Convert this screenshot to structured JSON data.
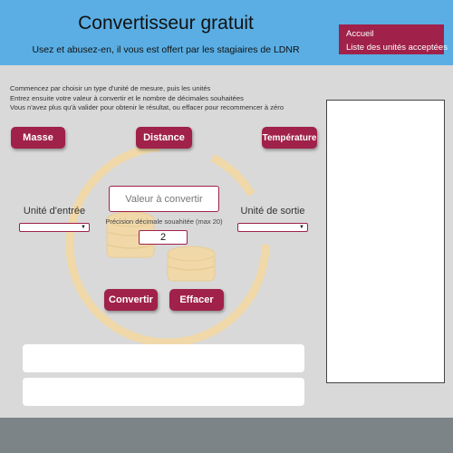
{
  "header": {
    "title": "Convertisseur gratuit",
    "subtitle": "Usez et abusez-en, il vous est offert par les stagiaires de LDNR",
    "nav": [
      "Accueil",
      "Liste des unités acceptées"
    ]
  },
  "instructions": [
    "Commencez par choisir un type d'unité de mesure, puis les unités",
    "Entrez ensuite votre valeur à convertir et le nombre de décimales souhaitées",
    "Vous n'avez plus qu'à valider pour obtenir le résultat, ou effacer pour recommencer à zéro"
  ],
  "categories": {
    "masse": "Masse",
    "distance": "Distance",
    "temperature": "Température"
  },
  "converter": {
    "input_unit_label": "Unité d'entrée",
    "output_unit_label": "Unité de sortie",
    "value_placeholder": "Valeur à convertir",
    "precision_label": "Précision décimale souahitée (max 20)",
    "decimals_value": "2",
    "convert_label": "Convertir",
    "clear_label": "Effacer"
  },
  "colors": {
    "header": "#5aaee3",
    "accent": "#a0214a",
    "background": "#d9d9d9",
    "footer": "#7d8487",
    "watermark": "#f0d8a8"
  }
}
